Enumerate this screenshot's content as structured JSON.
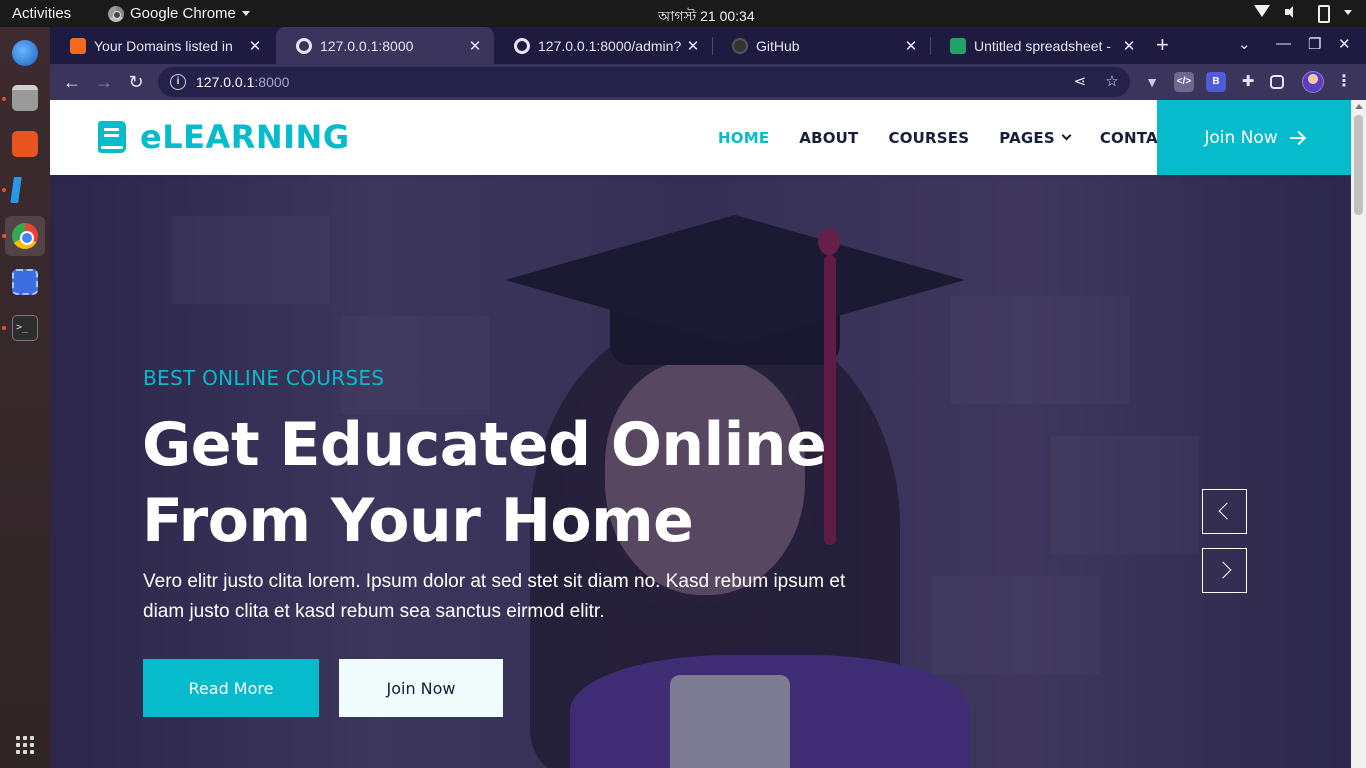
{
  "system": {
    "activities": "Activities",
    "app_name": "Google Chrome",
    "clock": "আগস্ট 21  00:34"
  },
  "dock": {
    "apps": [
      "thunderbird-icon",
      "files-icon",
      "software-store-icon",
      "vscode-icon",
      "chrome-icon",
      "screenshot-icon",
      "terminal-icon"
    ],
    "show_apps": "apps-grid-icon"
  },
  "browser": {
    "tabs": [
      {
        "title": "Your Domains listed in",
        "favicon": "orange-app-icon"
      },
      {
        "title": "127.0.0.1:8000",
        "favicon": "globe-icon",
        "active": true
      },
      {
        "title": "127.0.0.1:8000/admin?",
        "favicon": "globe-icon"
      },
      {
        "title": "GitHub",
        "favicon": "github-icon"
      },
      {
        "title": "Untitled spreadsheet -",
        "favicon": "sheets-icon"
      }
    ],
    "new_tab": "+",
    "url_host": "127.0.0.1",
    "url_port": ":8000"
  },
  "site": {
    "brand": "eLEARNING",
    "accent": "#06bbcc",
    "dark": "#181d38",
    "menu": [
      "HOME",
      "ABOUT",
      "COURSES",
      "PAGES",
      "CONTACT"
    ],
    "join_label": "Join Now",
    "hero": {
      "subtitle": "BEST ONLINE COURSES",
      "title": "Get Educated Online From Your Home",
      "text": "Vero elitr justo clita lorem. Ipsum dolor at sed stet sit diam no. Kasd rebum ipsum et diam justo clita et kasd rebum sea sanctus eirmod elitr.",
      "read_more": "Read More",
      "join_now": "Join Now"
    }
  }
}
